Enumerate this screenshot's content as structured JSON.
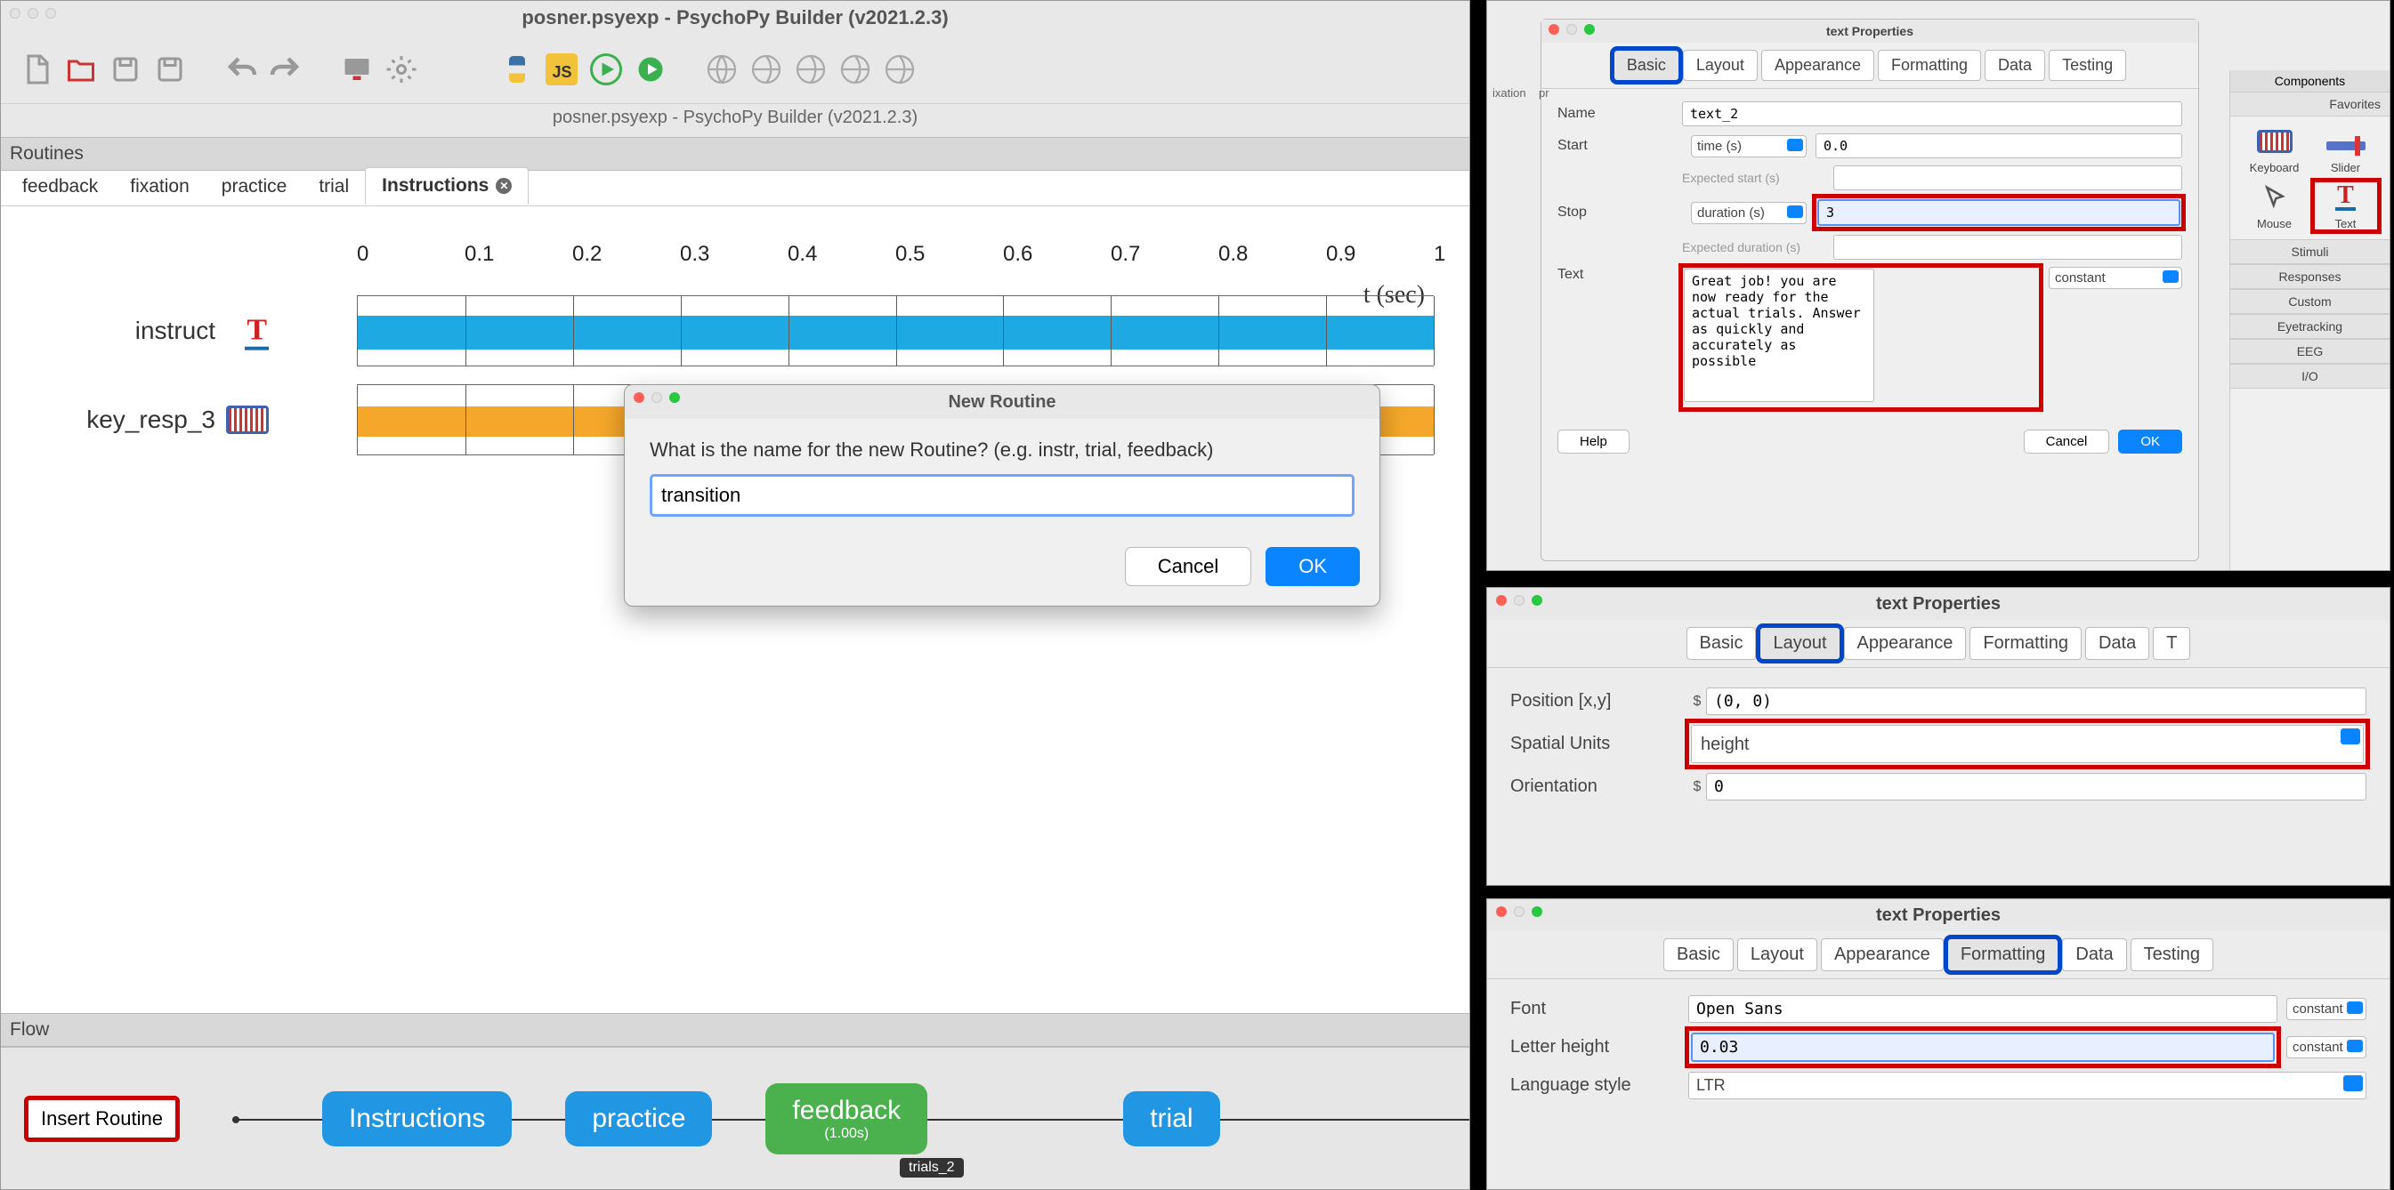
{
  "main": {
    "title": "posner.psyexp - PsychoPy Builder (v2021.2.3)",
    "subtitle": "posner.psyexp - PsychoPy Builder (v2021.2.3)",
    "routines_label": "Routines",
    "tabs": [
      "feedback",
      "fixation",
      "practice",
      "trial",
      "Instructions"
    ],
    "active_tab": "Instructions",
    "axis_label": "t (sec)",
    "ticks": [
      "0",
      "0.1",
      "0.2",
      "0.3",
      "0.4",
      "0.5",
      "0.6",
      "0.7",
      "0.8",
      "0.9",
      "1"
    ],
    "components": [
      {
        "name": "instruct",
        "icon": "text"
      },
      {
        "name": "key_resp_3",
        "icon": "keyboard"
      }
    ],
    "flow_label": "Flow",
    "insert_routine": "Insert Routine",
    "flow_nodes": [
      {
        "label": "Instructions",
        "color": "nblue"
      },
      {
        "label": "practice",
        "color": "nblue"
      },
      {
        "label": "feedback",
        "sub": "(1.00s)",
        "color": "ngreen"
      },
      {
        "label": "trial",
        "color": "nblue"
      }
    ],
    "trials_label": "trials_2"
  },
  "new_routine": {
    "title": "New Routine",
    "prompt": "What is the name for the new Routine? (e.g. instr, trial, feedback)",
    "value": "transition",
    "cancel": "Cancel",
    "ok": "OK"
  },
  "props_basic": {
    "title": "text Properties",
    "tabs": [
      "Basic",
      "Layout",
      "Appearance",
      "Formatting",
      "Data",
      "Testing"
    ],
    "active": "Basic",
    "name_label": "Name",
    "name": "text_2",
    "start_label": "Start",
    "start_mode": "time (s)",
    "start_val": "0.0",
    "start_hint": "Expected start (s)",
    "stop_label": "Stop",
    "stop_mode": "duration (s)",
    "stop_val": "3",
    "stop_hint": "Expected duration (s)",
    "text_label": "Text",
    "text": "Great job! you are now ready for the actual trials. Answer as quickly and accurately as possible",
    "text_mode": "constant",
    "help": "Help",
    "cancel": "Cancel",
    "ok": "OK",
    "palette_header": "Components",
    "palette_fav": "Favorites",
    "palette_items": [
      "Keyboard",
      "Slider",
      "Mouse",
      "Text"
    ],
    "palette_cats": [
      "Stimuli",
      "Responses",
      "Custom",
      "Eyetracking",
      "EEG",
      "I/O"
    ]
  },
  "props_layout": {
    "title": "text Properties",
    "tabs": [
      "Basic",
      "Layout",
      "Appearance",
      "Formatting",
      "Data",
      "T"
    ],
    "active": "Layout",
    "pos_label": "Position [x,y]",
    "pos": "(0, 0)",
    "units_label": "Spatial Units",
    "units": "height",
    "orient_label": "Orientation",
    "orient": "0"
  },
  "props_fmt": {
    "title": "text Properties",
    "tabs": [
      "Basic",
      "Layout",
      "Appearance",
      "Formatting",
      "Data",
      "Testing"
    ],
    "active": "Formatting",
    "font_label": "Font",
    "font": "Open Sans",
    "font_mode": "constant",
    "lh_label": "Letter height",
    "lh": "0.03",
    "lh_mode": "constant",
    "ls_label": "Language style",
    "ls": "LTR"
  },
  "chart_data": null
}
